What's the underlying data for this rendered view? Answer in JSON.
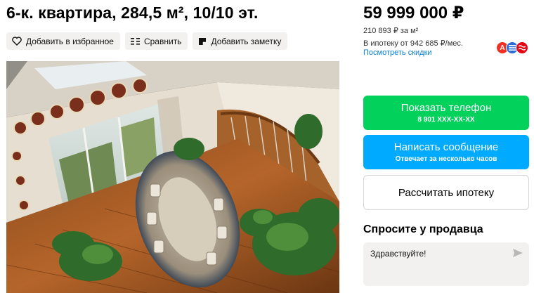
{
  "listing": {
    "title": "6-к. квартира, 284,5 м², 10/10 эт."
  },
  "actions": {
    "favorite": "Добавить в избранное",
    "compare": "Сравнить",
    "note": "Добавить заметку"
  },
  "price": {
    "total": "59 999 000 ₽",
    "per_meter": "210 893 ₽ за м²",
    "mortgage": "В ипотеку от 942 685 ₽/мес.",
    "discounts_link": "Посмотреть скидки"
  },
  "banks": [
    {
      "letter": "А",
      "color": "#ef3124"
    },
    {
      "letter": "≡",
      "color": "#2a6bd8"
    },
    {
      "letter": "≈",
      "color": "#e30613"
    }
  ],
  "buttons": {
    "phone_label": "Показать телефон",
    "phone_number": "8 901 XXX-XX-XX",
    "message_label": "Написать сообщение",
    "message_sub": "Отвечает за несколько часов",
    "mortgage_label": "Рассчитать ипотеку"
  },
  "seller": {
    "ask_title": "Спросите у продавца",
    "message_placeholder": "Здравствуйте!"
  },
  "colors": {
    "green": "#02d15c",
    "blue": "#00aaff",
    "link": "#0a7fd8"
  }
}
